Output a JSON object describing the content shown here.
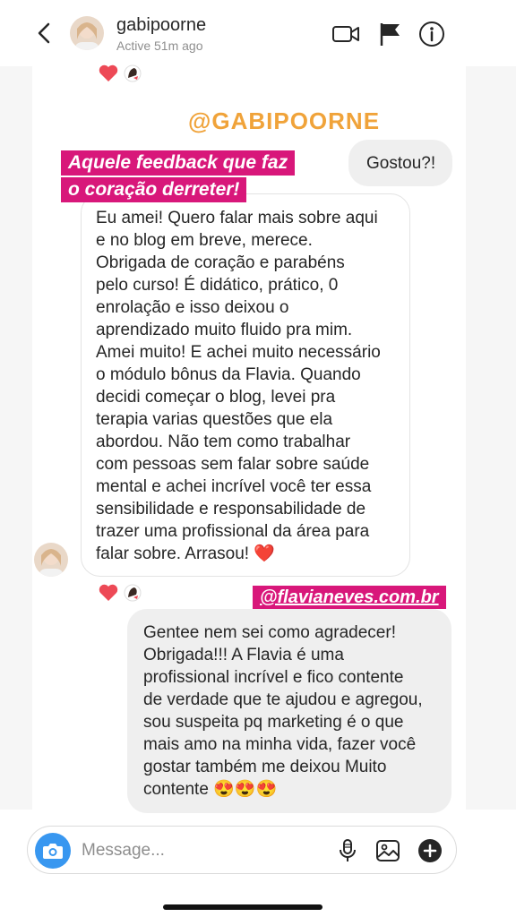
{
  "header": {
    "username": "gabipoorne",
    "status": "Active 51m ago",
    "back_icon": "chevron-left-icon",
    "video_icon": "video-camera-icon",
    "flag_icon": "flag-icon",
    "info_icon": "info-icon"
  },
  "overlay": {
    "mention_top": "@GABIPOORNE",
    "headline_line1": "Aquele feedback que faz",
    "headline_line2": "o coração derreter!",
    "mention_bottom": "@flavianeves.com.br"
  },
  "messages": {
    "sent_1": "Gostou?!",
    "received_1": "Eu amei! Quero falar mais sobre aqui\ne no blog em breve, merece.\nObrigada de coração e parabéns\npelo curso! É didático, prático, 0\nenrolação e isso deixou o\naprendizado muito fluido pra mim.\nAmei muito! E achei muito necessário\no módulo bônus da Flavia. Quando\ndecidi começar o blog, levei pra\nterapia varias questões que ela\nabordou. Não tem como trabalhar\ncom pessoas sem falar sobre saúde\nmental e achei incrível você ter essa\nsensibilidade e responsabilidade de\ntrazer uma profissional da área para\nfalar sobre. Arrasou! ❤️",
    "sent_2": "Gentee nem sei como agradecer!\nObrigada!!! A Flavia é uma\nprofissional incrível e fico contente\nde verdade que te ajudou e agregou,\nsou suspeita pq marketing é o que\nmais amo na minha vida, fazer você\ngostar também me deixou Muito\ncontente 😍😍😍"
  },
  "composer": {
    "placeholder": "Message...",
    "camera_icon": "camera-icon",
    "mic_icon": "microphone-icon",
    "gallery_icon": "gallery-icon",
    "plus_icon": "plus-circle-icon"
  },
  "colors": {
    "highlight": "#d8177a",
    "mention_orange": "#f0a33a",
    "heart": "#ed4956",
    "accent_blue": "#3897f0"
  }
}
